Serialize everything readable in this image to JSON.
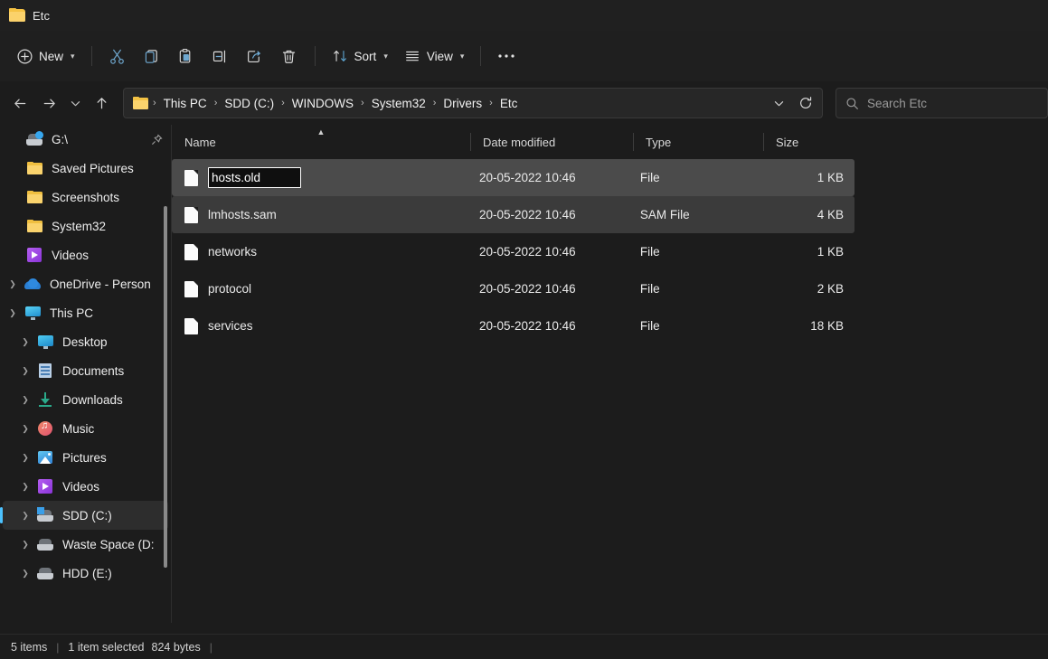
{
  "window": {
    "tab_title": "Etc",
    "folder_icon": "folder-icon"
  },
  "toolbar": {
    "new_label": "New",
    "cut_icon": "cut-icon",
    "copy_icon": "copy-icon",
    "paste_icon": "paste-icon",
    "rename_icon": "rename-icon",
    "share_icon": "share-icon",
    "delete_icon": "delete-icon",
    "sort_label": "Sort",
    "sort_icon": "sort-icon",
    "view_label": "View",
    "view_icon": "view-icon",
    "more_icon": "ellipsis-icon"
  },
  "navigation": {
    "back_icon": "back-arrow-icon",
    "forward_icon": "forward-arrow-icon",
    "recent_icon": "chevron-down-icon",
    "up_icon": "up-arrow-icon",
    "dropdown_icon": "chevron-down-icon",
    "refresh_icon": "refresh-icon"
  },
  "breadcrumb": {
    "items": [
      "This PC",
      "SDD (C:)",
      "WINDOWS",
      "System32",
      "Drivers",
      "Etc"
    ],
    "separator": "›"
  },
  "search": {
    "placeholder": "Search Etc",
    "value": "",
    "icon": "search-icon"
  },
  "sidebar": {
    "items": [
      {
        "label": "G:\\",
        "icon": "network-drive-icon",
        "expander": "",
        "pinned": true,
        "indent": 1,
        "selected": false
      },
      {
        "label": "Saved Pictures",
        "icon": "folder-icon",
        "expander": "",
        "pinned": false,
        "indent": 1,
        "selected": false
      },
      {
        "label": "Screenshots",
        "icon": "folder-icon",
        "expander": "",
        "pinned": false,
        "indent": 1,
        "selected": false
      },
      {
        "label": "System32",
        "icon": "folder-icon",
        "expander": "",
        "pinned": false,
        "indent": 1,
        "selected": false
      },
      {
        "label": "Videos",
        "icon": "videos-icon",
        "expander": "",
        "pinned": false,
        "indent": 1,
        "selected": false
      },
      {
        "label": "OneDrive - Person",
        "icon": "onedrive-icon",
        "expander": "collapsed",
        "pinned": false,
        "indent": 0,
        "selected": false
      },
      {
        "label": "This PC",
        "icon": "this-pc-icon",
        "expander": "expanded",
        "pinned": false,
        "indent": 0,
        "selected": false
      },
      {
        "label": "Desktop",
        "icon": "desktop-icon",
        "expander": "collapsed",
        "pinned": false,
        "indent": 1,
        "selected": false
      },
      {
        "label": "Documents",
        "icon": "documents-icon",
        "expander": "collapsed",
        "pinned": false,
        "indent": 1,
        "selected": false
      },
      {
        "label": "Downloads",
        "icon": "downloads-icon",
        "expander": "collapsed",
        "pinned": false,
        "indent": 1,
        "selected": false
      },
      {
        "label": "Music",
        "icon": "music-icon",
        "expander": "collapsed",
        "pinned": false,
        "indent": 1,
        "selected": false
      },
      {
        "label": "Pictures",
        "icon": "pictures-icon",
        "expander": "collapsed",
        "pinned": false,
        "indent": 1,
        "selected": false
      },
      {
        "label": "Videos",
        "icon": "videos-icon",
        "expander": "collapsed",
        "pinned": false,
        "indent": 1,
        "selected": false
      },
      {
        "label": "SDD (C:)",
        "icon": "system-drive-icon",
        "expander": "collapsed",
        "pinned": false,
        "indent": 1,
        "selected": true
      },
      {
        "label": "Waste Space (D:",
        "icon": "drive-icon",
        "expander": "collapsed",
        "pinned": false,
        "indent": 1,
        "selected": false
      },
      {
        "label": "HDD (E:)",
        "icon": "drive-icon",
        "expander": "collapsed",
        "pinned": false,
        "indent": 1,
        "selected": false
      }
    ]
  },
  "filelist": {
    "columns": [
      {
        "label": "Name",
        "sorted": "asc"
      },
      {
        "label": "Date modified",
        "sorted": ""
      },
      {
        "label": "Type",
        "sorted": ""
      },
      {
        "label": "Size",
        "sorted": ""
      }
    ],
    "rows": [
      {
        "name": "hosts.old",
        "date": "20-05-2022 10:46",
        "type": "File",
        "size": "1 KB",
        "state": "renaming"
      },
      {
        "name": "lmhosts.sam",
        "date": "20-05-2022 10:46",
        "type": "SAM File",
        "size": "4 KB",
        "state": "selected"
      },
      {
        "name": "networks",
        "date": "20-05-2022 10:46",
        "type": "File",
        "size": "1 KB",
        "state": ""
      },
      {
        "name": "protocol",
        "date": "20-05-2022 10:46",
        "type": "File",
        "size": "2 KB",
        "state": ""
      },
      {
        "name": "services",
        "date": "20-05-2022 10:46",
        "type": "File",
        "size": "18 KB",
        "state": ""
      }
    ],
    "rename_value": "hosts.old"
  },
  "statusbar": {
    "item_count": "5 items",
    "selection": "1 item selected",
    "selection_size": "824 bytes",
    "divider": "|"
  },
  "colors": {
    "background": "#1c1c1c",
    "accent": "#4cc2ff",
    "selected_row": "#4b4b4b",
    "folder_yellow": "#f0bf40"
  }
}
